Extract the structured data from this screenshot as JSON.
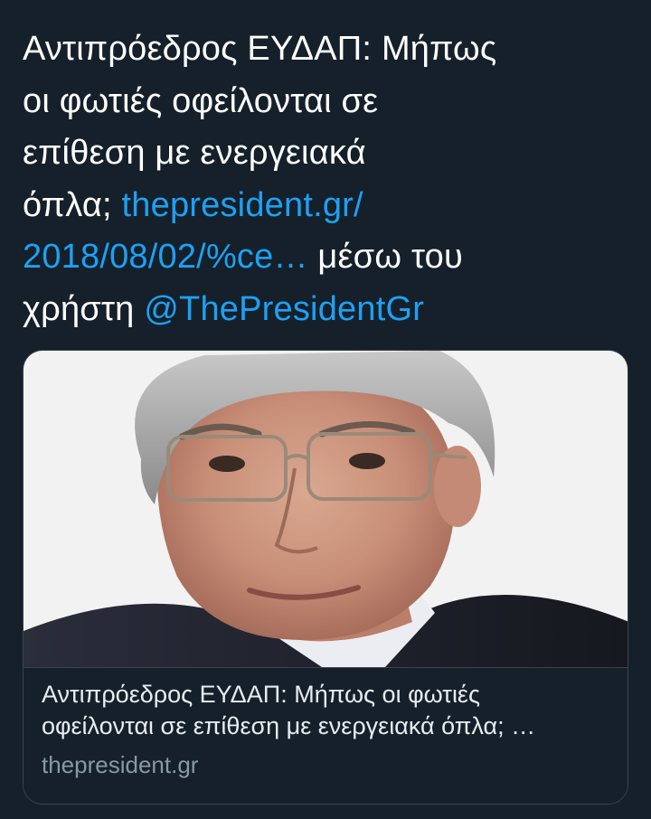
{
  "tweet": {
    "text_line1": "Αντιπρόεδρος ΕΥΔΑΠ: Μήπως",
    "text_line2": "οι φωτιές οφείλονται σε",
    "text_line3": "επίθεση με ενεργειακά",
    "text_line4_prefix": "όπλα; ",
    "link_part1": "thepresident.gr/",
    "link_part2": "2018/08/02/%ce…",
    "via_text": " μέσω του",
    "via_text2": "χρήστη ",
    "mention": "@ThePresidentGr"
  },
  "card": {
    "title_line1": "Αντιπρόεδρος ΕΥΔΑΠ: Μήπως οι φωτιές",
    "title_line2": "οφείλονται σε επίθεση με ενεργειακά όπλα; …",
    "domain": "thepresident.gr"
  },
  "colors": {
    "background": "#15202b",
    "link": "#1da1f2",
    "text": "#ffffff",
    "muted": "#8899a6",
    "border": "#38444d"
  }
}
